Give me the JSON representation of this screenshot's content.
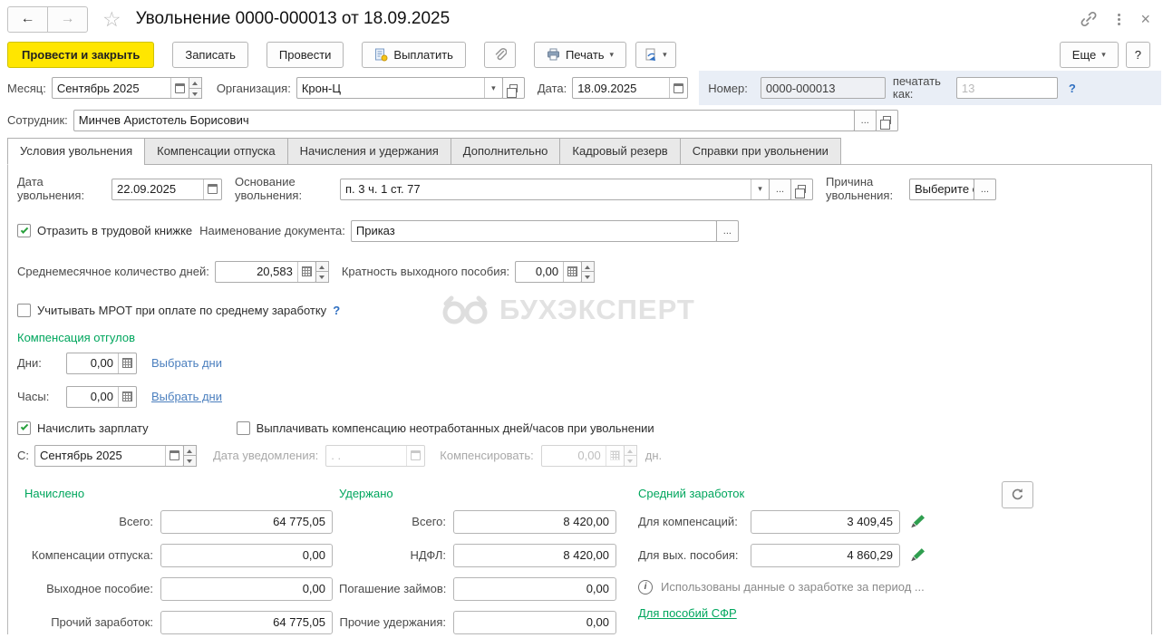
{
  "header": {
    "title": "Увольнение 0000-000013 от 18.09.2025"
  },
  "toolbar": {
    "post_and_close": "Провести и закрыть",
    "save": "Записать",
    "post": "Провести",
    "pay": "Выплатить",
    "print": "Печать",
    "more": "Еще",
    "help": "?"
  },
  "doc": {
    "month_label": "Месяц:",
    "month_value": "Сентябрь 2025",
    "org_label": "Организация:",
    "org_value": "Крон-Ц",
    "date_label": "Дата:",
    "date_value": "18.09.2025",
    "number_label": "Номер:",
    "number_value": "0000-000013",
    "print_as_label": "печатать как:",
    "print_as_value": "13",
    "print_as_help": "?",
    "employee_label": "Сотрудник:",
    "employee_value": "Минчев Аристотель Борисович"
  },
  "tabs": [
    {
      "label": "Условия увольнения"
    },
    {
      "label": "Компенсации отпуска"
    },
    {
      "label": "Начисления и удержания"
    },
    {
      "label": "Дополнительно"
    },
    {
      "label": "Кадровый резерв"
    },
    {
      "label": "Справки при увольнении"
    }
  ],
  "form": {
    "dismissal_date_label": "Дата увольнения:",
    "dismissal_date_value": "22.09.2025",
    "grounds_label": "Основание увольнения:",
    "grounds_value": "п. 3 ч. 1 ст. 77",
    "reason_label": "Причина увольнения:",
    "reason_value": "Выберите о",
    "workbook_checkbox": "Отразить в трудовой книжке",
    "doc_name_label": "Наименование документа:",
    "doc_name_value": "Приказ",
    "avg_days_label": "Среднемесячное количество дней:",
    "avg_days_value": "20,583",
    "severance_label": "Кратность выходного пособия:",
    "severance_value": "0,00",
    "mrot_checkbox": "Учитывать МРОТ при оплате по среднему заработку",
    "mrot_help": "?",
    "watermark": "БУХЭКСПЕРТ",
    "timeoff": {
      "header": "Компенсация отгулов",
      "days_label": "Дни:",
      "days_value": "0,00",
      "days_link": "Выбрать дни",
      "hours_label": "Часы:",
      "hours_value": "0,00",
      "hours_link": "Выбрать дни"
    },
    "accrue_checkbox": "Начислить зарплату",
    "paycomp_checkbox": "Выплачивать компенсацию неотработанных дней/часов при увольнении",
    "from_label": "С:",
    "from_value": "Сентябрь 2025",
    "notice_label": "Дата уведомления:",
    "notice_value": ". .",
    "compensate_label": "Компенсировать:",
    "compensate_value": "0,00",
    "compensate_suffix": "дн."
  },
  "totals": {
    "accrued": {
      "header": "Начислено",
      "rows": [
        {
          "label": "Всего:",
          "value": "64 775,05"
        },
        {
          "label": "Компенсации отпуска:",
          "value": "0,00"
        },
        {
          "label": "Выходное пособие:",
          "value": "0,00"
        },
        {
          "label": "Прочий заработок:",
          "value": "64 775,05"
        }
      ]
    },
    "withheld": {
      "header": "Удержано",
      "rows": [
        {
          "label": "Всего:",
          "value": "8 420,00"
        },
        {
          "label": "НДФЛ:",
          "value": "8 420,00"
        },
        {
          "label": "Погашение займов:",
          "value": "0,00"
        },
        {
          "label": "Прочие удержания:",
          "value": "0,00"
        }
      ]
    },
    "average": {
      "header": "Средний заработок",
      "rows": [
        {
          "label": "Для компенсаций:",
          "value": "3 409,45"
        },
        {
          "label": "Для вых. пособия:",
          "value": "4 860,29"
        }
      ],
      "info": "Использованы данные о заработке за период ...",
      "sfr_link": "Для пособий СФР"
    }
  },
  "icons": {
    "back": "←",
    "forward": "→",
    "star": "☆",
    "close": "×",
    "caret": "▾",
    "ellipsis": "...",
    "info_letter": "i"
  },
  "colors": {
    "accent_yellow": "#ffe600",
    "section_green": "#00a65d",
    "link_blue": "#4b7fbe"
  }
}
